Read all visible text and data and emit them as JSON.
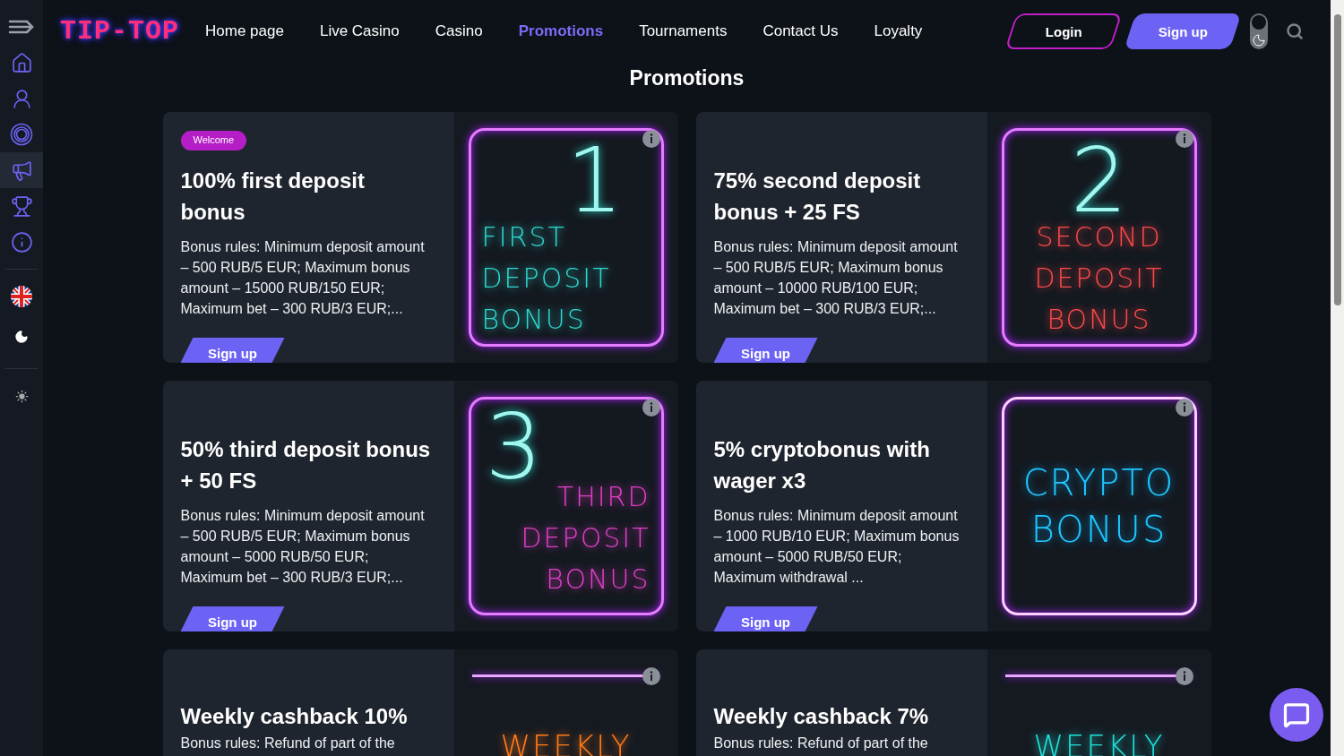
{
  "sidebar": {
    "items": [
      {
        "kind": "home",
        "selected": false
      },
      {
        "kind": "person",
        "selected": false
      },
      {
        "kind": "chip",
        "selected": false
      },
      {
        "kind": "megaphone",
        "selected": true
      },
      {
        "kind": "trophy",
        "selected": false
      },
      {
        "kind": "info",
        "selected": false
      }
    ]
  },
  "header": {
    "logo": "TIP-TOP",
    "nav": [
      {
        "label": "Home page",
        "selected": false
      },
      {
        "label": "Live Casino",
        "selected": false
      },
      {
        "label": "Casino",
        "selected": false
      },
      {
        "label": "Promotions",
        "selected": true
      },
      {
        "label": "Tournaments",
        "selected": false
      },
      {
        "label": "Contact Us",
        "selected": false
      },
      {
        "label": "Loyalty",
        "selected": false
      }
    ],
    "login": "Login",
    "signup": "Sign up"
  },
  "page_title": "Promotions",
  "promotions": [
    {
      "badge": "Welcome",
      "title": "100% first deposit bonus",
      "rules": "Bonus rules: Minimum deposit amount – 500 RUB/5 EUR; Maximum bonus amount – 15000 RUB/150 EUR; Maximum bet – 300 RUB/3 EUR;...",
      "button": "Sign up",
      "banner": {
        "kind": "right",
        "number": "1",
        "lines": [
          "FIRST",
          "DEPOSIT",
          "BONUS"
        ],
        "color": "#2fd8cf"
      }
    },
    {
      "title": "75% second deposit bonus + 25 FS",
      "rules": "Bonus rules: Minimum deposit amount – 500 RUB/5 EUR; Maximum bonus amount – 10000 RUB/100 EUR; Maximum bet – 300 RUB/3 EUR;...",
      "button": "Sign up",
      "banner": {
        "kind": "center",
        "number": "2",
        "lines": [
          "SECOND",
          "DEPOSIT",
          "BONUS"
        ],
        "color": "#ff4a4a"
      }
    },
    {
      "title": "50% third deposit bonus + 50 FS",
      "rules": "Bonus rules: Minimum deposit amount – 500 RUB/5 EUR; Maximum bonus amount – 5000 RUB/50 EUR; Maximum bet – 300 RUB/3 EUR;...",
      "button": "Sign up",
      "banner": {
        "kind": "left",
        "number": "3",
        "lines": [
          "THIRD",
          "DEPOSIT",
          "BONUS"
        ],
        "color": "#e23fc8"
      }
    },
    {
      "title": "5% cryptobonus with wager x3",
      "rules": "Bonus rules: Minimum deposit amount – 1000 RUB/10 EUR; Maximum bonus amount – 5000 RUB/50 EUR; Maximum withdrawal ...",
      "button": "Sign up",
      "banner": {
        "kind": "plain",
        "lines": [
          "CRYPTO",
          "BONUS"
        ],
        "color": "#1ec8ff"
      }
    },
    {
      "title": "Weekly cashback 10%",
      "rules": "Bonus rules: Refund of part of the",
      "banner": {
        "kind": "strip",
        "lines": [
          "WEEKLY"
        ],
        "color": "#ff7a1a"
      }
    },
    {
      "title": "Weekly cashback 7%",
      "rules": "Bonus rules: Refund of part of the",
      "banner": {
        "kind": "strip",
        "lines": [
          "WEEKLY"
        ],
        "color": "#1ee0d8"
      }
    }
  ]
}
